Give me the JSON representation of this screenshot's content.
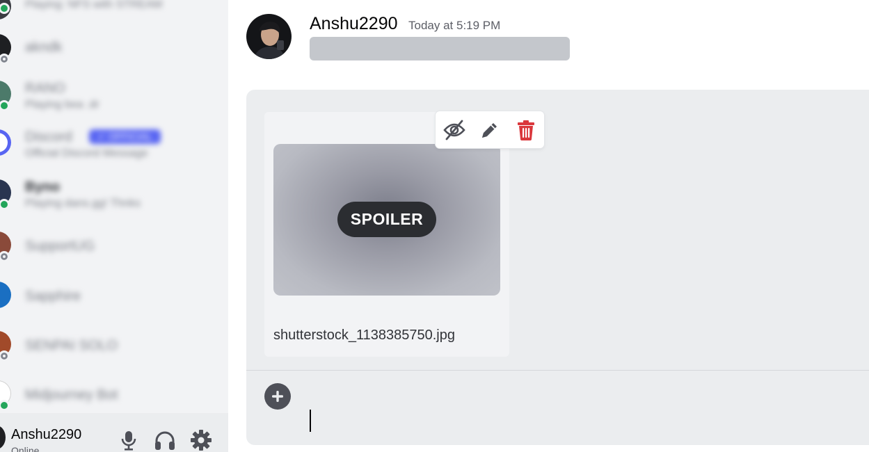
{
  "sidebar": {
    "dms": [
      {
        "name": "Playing: NFS with STREAM",
        "sub": "",
        "status": "online"
      },
      {
        "name": "akndk",
        "sub": "",
        "status": "offline"
      },
      {
        "name": "RANO",
        "sub": "Playing bea .dr",
        "status": "online"
      },
      {
        "name": "Discord",
        "badge": "✓ OFFICIAL",
        "sub": "Official Discord Message",
        "status": "none"
      },
      {
        "name": "Byno",
        "sub": "Playing dans.gg! Thnks",
        "status": "online"
      },
      {
        "name": "SupportUG",
        "sub": "",
        "status": "offline"
      },
      {
        "name": "Sapphire",
        "sub": "",
        "status": "none"
      },
      {
        "name": "SENPAI SOLO",
        "sub": "",
        "status": "offline"
      },
      {
        "name": "Midjourney Bot",
        "sub": "",
        "status": "online"
      }
    ],
    "user_panel": {
      "username": "Anshu2290",
      "status": "Online"
    }
  },
  "message": {
    "author": "Anshu2290",
    "timestamp": "Today at 5:19 PM"
  },
  "composer": {
    "attachment": {
      "spoiler_label": "SPOILER",
      "filename": "shutterstock_1138385750.jpg"
    },
    "actions": [
      "eye-slash-icon",
      "pencil-icon",
      "trash-icon"
    ],
    "input_value": ""
  },
  "colors": {
    "online": "#23a55a",
    "delete": "#da373c",
    "brand": "#5865f2"
  }
}
